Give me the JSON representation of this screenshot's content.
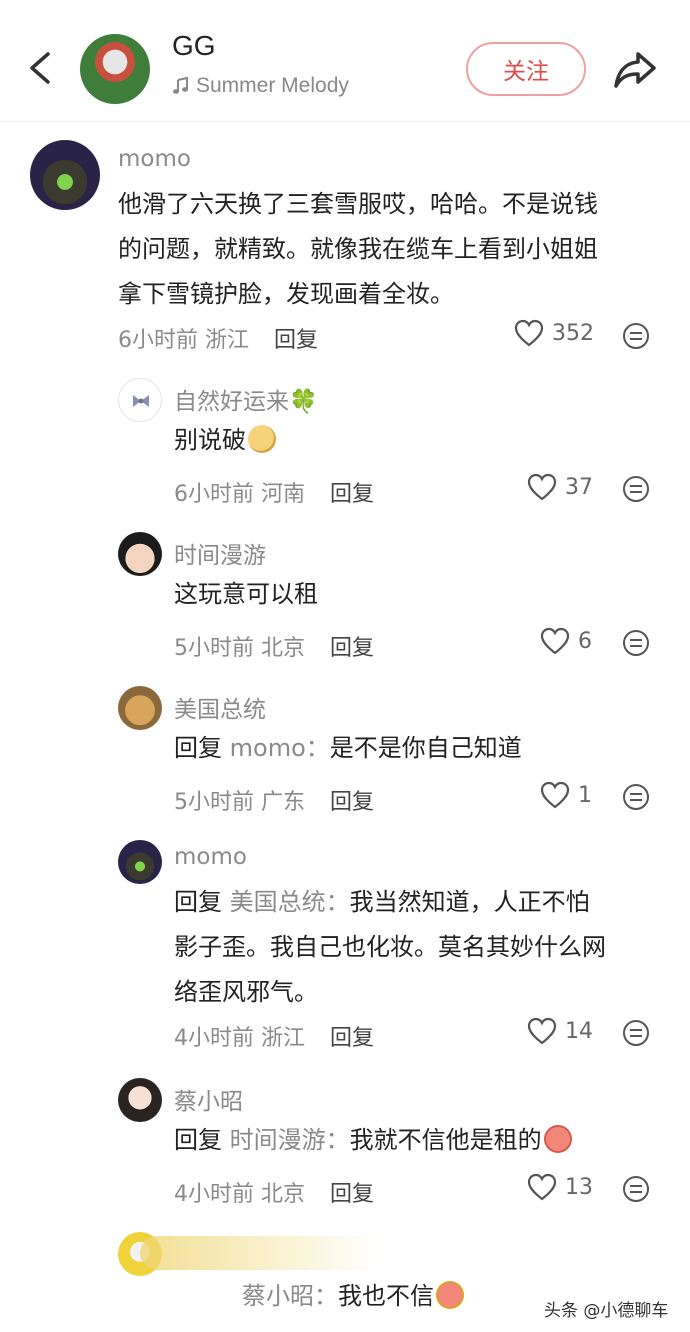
{
  "header": {
    "back_icon": "chevron-left-icon",
    "user_name": "GG",
    "music_icon": "music-note-icon",
    "music_title": "Summer Melody",
    "follow_label": "关注",
    "share_icon": "share-arrow-icon"
  },
  "comments": [
    {
      "user": "momo",
      "lines": [
        "他滑了六天换了三套雪服哎，哈哈。不是说钱",
        "的问题，就精致。就像我在缆车上看到小姐姐",
        "拿下雪镜护脸，发现画着全妆。"
      ],
      "time": "6小时前",
      "location": "浙江",
      "reply_label": "回复",
      "likes": "352"
    },
    {
      "user": "自然好运来🍀",
      "text": "别说破",
      "time": "6小时前",
      "location": "河南",
      "reply_label": "回复",
      "likes": "37"
    },
    {
      "user": "时间漫游",
      "text": "这玩意可以租",
      "time": "5小时前",
      "location": "北京",
      "reply_label": "回复",
      "likes": "6"
    },
    {
      "user": "美国总统",
      "reply_prefix": "回复",
      "reply_target": "momo：",
      "text": "是不是你自己知道",
      "time": "5小时前",
      "location": "广东",
      "reply_label": "回复",
      "likes": "1"
    },
    {
      "user": "momo",
      "reply_prefix": "回复",
      "reply_target": "美国总统：",
      "line1": "我当然知道，人正不怕",
      "line2": "影子歪。我自己也化妆。莫名其妙什么网",
      "line3": "络歪风邪气。",
      "time": "4小时前",
      "location": "浙江",
      "reply_label": "回复",
      "likes": "14"
    },
    {
      "user": "蔡小昭",
      "reply_prefix": "回复",
      "reply_target": "时间漫游：",
      "text": "我就不信他是租的",
      "time": "4小时前",
      "location": "北京",
      "reply_label": "回复",
      "likes": "13"
    },
    {
      "reply_target": "蔡小昭：",
      "text": "我也不信"
    }
  ],
  "watermark": "头条 @小德聊车",
  "icons": {
    "like": "heart-outline-icon",
    "more": "more-dots-icon"
  }
}
